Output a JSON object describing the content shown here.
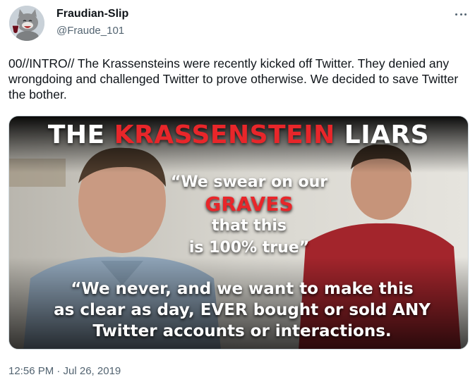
{
  "user": {
    "display_name": "Fraudian-Slip",
    "handle": "@Fraude_101",
    "avatar_icon": "cat-with-wine-avatar"
  },
  "more_icon": "more-options-icon",
  "tweet": {
    "text": "00//INTRO// The Krassensteins were recently kicked off Twitter. They denied any wrongdoing and challenged Twitter to prove otherwise. We decided to save Twitter the bother.",
    "timestamp": "12:56 PM · Jul 26, 2019"
  },
  "media": {
    "headline_white_1": "THE ",
    "headline_red": "KRASSENSTEIN",
    "headline_white_2": " LIARS",
    "quote1_line1": "“We swear on our",
    "quote1_red": "GRAVES",
    "quote1_line3": "that this",
    "quote1_line4": "is 100% true”",
    "quote2_line1": "“We never, and we want to make this",
    "quote2_line2": "as clear as day, EVER bought or sold ANY",
    "quote2_line3": "Twitter accounts or interactions."
  },
  "colors": {
    "accent_red": "#e8262a",
    "secondary_text": "#536471"
  }
}
